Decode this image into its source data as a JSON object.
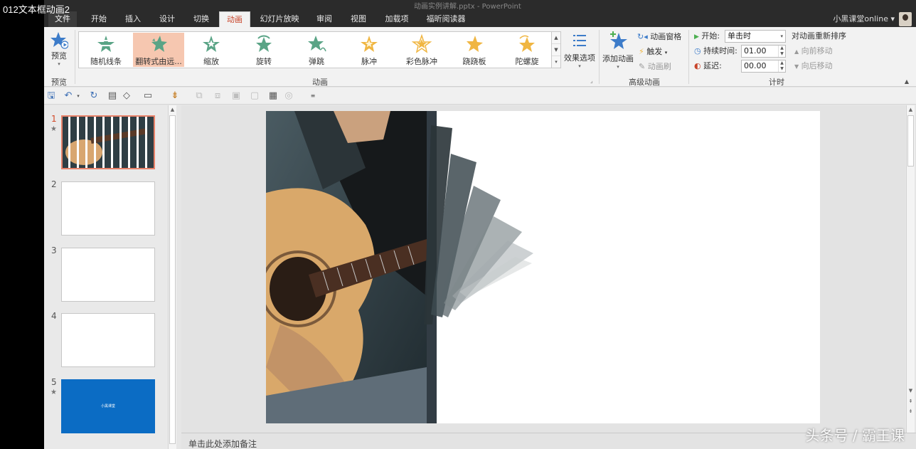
{
  "video_title": "012文本框动画2",
  "window": {
    "title": "动画实例讲解.pptx - PowerPoint"
  },
  "tabs": [
    {
      "label": "文件"
    },
    {
      "label": "开始"
    },
    {
      "label": "插入"
    },
    {
      "label": "设计"
    },
    {
      "label": "切换"
    },
    {
      "label": "动画"
    },
    {
      "label": "幻灯片放映"
    },
    {
      "label": "审阅"
    },
    {
      "label": "视图"
    },
    {
      "label": "加载项"
    },
    {
      "label": "福昕阅读器"
    }
  ],
  "user_name": "小黑课堂online",
  "ribbon": {
    "preview": {
      "label": "预览",
      "group": "预览"
    },
    "gallery": {
      "group": "动画",
      "items": [
        {
          "label": "随机线条",
          "color": "#5aa486"
        },
        {
          "label": "翻转式由远...",
          "color": "#5aa486"
        },
        {
          "label": "缩放",
          "color": "#5aa486"
        },
        {
          "label": "旋转",
          "color": "#5aa486"
        },
        {
          "label": "弹跳",
          "color": "#5aa486"
        },
        {
          "label": "脉冲",
          "color": "#f0b642"
        },
        {
          "label": "彩色脉冲",
          "color": "#f0b642"
        },
        {
          "label": "跷跷板",
          "color": "#f0b642"
        },
        {
          "label": "陀螺旋",
          "color": "#f0b642"
        }
      ]
    },
    "effect_options": "效果选项",
    "advanced": {
      "group": "高级动画",
      "add_animation": "添加动画",
      "pane": "动画窗格",
      "trigger": "触发",
      "painter": "动画刷"
    },
    "timing": {
      "group": "计时",
      "start_label": "开始:",
      "start_value": "单击时",
      "duration_label": "持续时间:",
      "duration_value": "01.00",
      "delay_label": "延迟:",
      "delay_value": "00.00",
      "reorder": "对动画重新排序",
      "move_earlier": "向前移动",
      "move_later": "向后移动"
    }
  },
  "slides": [
    {
      "num": "1",
      "star": "★"
    },
    {
      "num": "2",
      "star": ""
    },
    {
      "num": "3",
      "star": ""
    },
    {
      "num": "4",
      "star": ""
    },
    {
      "num": "5",
      "star": "★",
      "thumb_text": "小黑课堂"
    }
  ],
  "notes_placeholder": "单击此处添加备注",
  "watermark": "头条号 / 霸王课"
}
